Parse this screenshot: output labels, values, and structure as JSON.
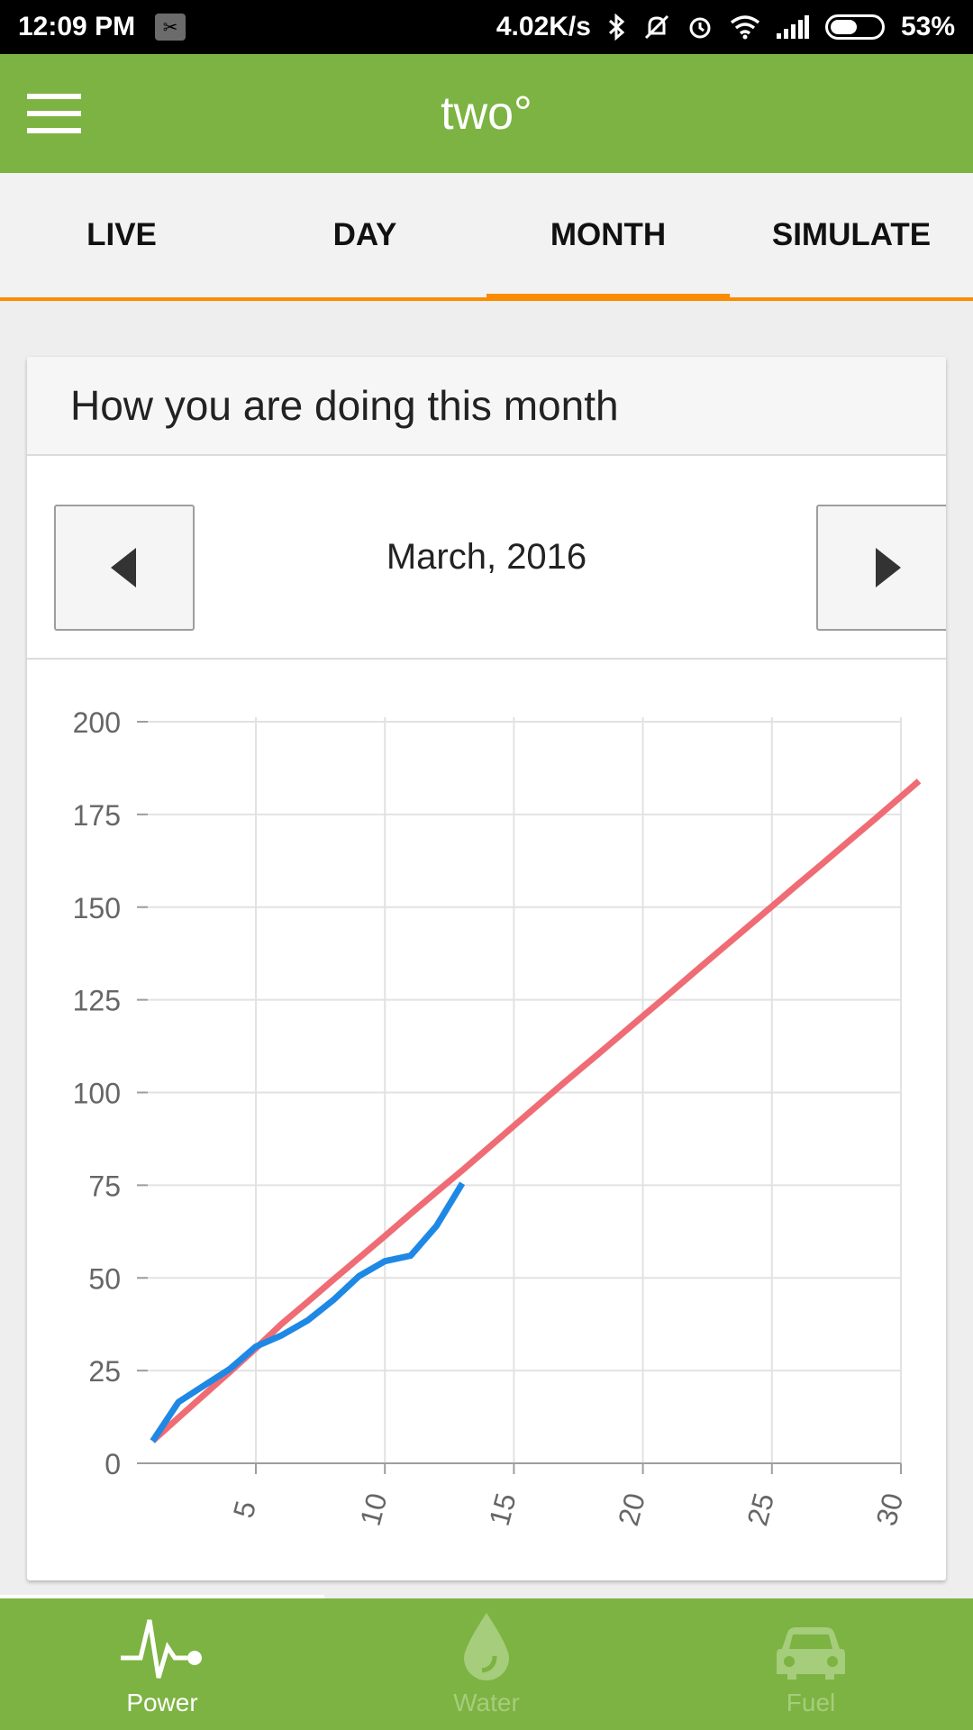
{
  "status_bar": {
    "time": "12:09 PM",
    "speed": "4.02K/s",
    "battery": "53%",
    "battery_level": 0.53
  },
  "app": {
    "title": "two°"
  },
  "tabs": [
    {
      "label": "LIVE"
    },
    {
      "label": "DAY"
    },
    {
      "label": "MONTH"
    },
    {
      "label": "SIMULATE"
    }
  ],
  "active_tab": "MONTH",
  "card": {
    "title": "How you are doing this month",
    "month": "March, 2016"
  },
  "colors": {
    "accent": "#7cb342",
    "tab_indicator": "#fb8c00",
    "actual_line": "#1e88e5",
    "target_line": "#ef6c75"
  },
  "chart_data": {
    "type": "line",
    "ylim": [
      0,
      200
    ],
    "xlim": [
      0,
      30
    ],
    "yticks": [
      0,
      25,
      50,
      75,
      100,
      125,
      150,
      175,
      200
    ],
    "xticks": [
      5,
      10,
      15,
      20,
      25,
      30
    ],
    "grid": true,
    "series": [
      {
        "color": "#ef6c75",
        "x": [
          1,
          2,
          3,
          4,
          5,
          6,
          7,
          8,
          9,
          10,
          11,
          12,
          13,
          14,
          15,
          16,
          17,
          18,
          19,
          20,
          21,
          22,
          23,
          24,
          25,
          26,
          27,
          28,
          29,
          30,
          30.7
        ],
        "y": [
          6,
          12.3,
          18.5,
          24.7,
          31,
          37.6,
          43.5,
          49.5,
          55.4,
          61.3,
          67.3,
          73.2,
          79,
          85,
          91,
          97,
          103,
          108.8,
          114.7,
          120.6,
          126.5,
          132.5,
          138.4,
          144.3,
          150.2,
          156.1,
          162,
          167.9,
          173.8,
          179.8,
          184
        ]
      },
      {
        "color": "#1e88e5",
        "x": [
          1,
          2,
          3,
          4,
          5,
          6,
          7,
          8,
          9,
          10,
          11,
          12,
          13
        ],
        "y": [
          6,
          16.5,
          21,
          25.5,
          31.5,
          34.5,
          38.5,
          44,
          50.5,
          54.5,
          56,
          64,
          75.5
        ]
      }
    ]
  },
  "bottom_nav": [
    {
      "label": "Power",
      "icon": "pulse-icon"
    },
    {
      "label": "Water",
      "icon": "water-drop-icon"
    },
    {
      "label": "Fuel",
      "icon": "car-icon"
    }
  ]
}
